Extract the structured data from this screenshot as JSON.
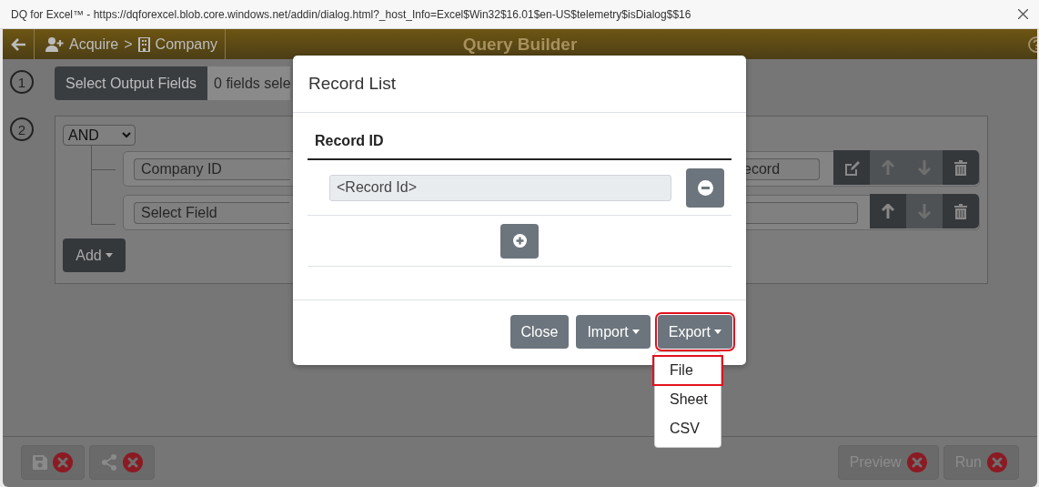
{
  "window": {
    "title": "DQ for Excel™ - https://dqforexcel.blob.core.windows.net/addin/dialog.html?_host_Info=Excel$Win32$16.01$en-US$telemetry$isDialog$$16"
  },
  "header": {
    "breadcrumb": [
      {
        "label": "Acquire",
        "kind": "user"
      },
      {
        "label": "Company",
        "kind": "building"
      }
    ],
    "separator": ">",
    "title": "Query Builder"
  },
  "output_fields": {
    "step": "1",
    "button": "Select Output Fields",
    "summary": "0 fields sele"
  },
  "query": {
    "step": "2",
    "operator": "AND",
    "rules": [
      {
        "field": "Company ID",
        "value": "ecord",
        "buttons": [
          {
            "kind": "edit",
            "disabled": false
          },
          {
            "kind": "up",
            "disabled": true
          },
          {
            "kind": "down",
            "disabled": true
          },
          {
            "kind": "delete",
            "disabled": false
          }
        ]
      },
      {
        "field": "Select Field",
        "buttons": [
          {
            "kind": "up",
            "disabled": false
          },
          {
            "kind": "down",
            "disabled": true
          },
          {
            "kind": "delete",
            "disabled": false
          }
        ]
      }
    ],
    "add_button": "Add"
  },
  "footer": {
    "left": [
      {
        "kind": "save"
      },
      {
        "kind": "share"
      }
    ],
    "right": [
      {
        "label": "Preview"
      },
      {
        "label": "Run"
      }
    ]
  },
  "dialog": {
    "title": "Record List",
    "column": "Record ID",
    "records": [
      {
        "value": "<Record Id>"
      }
    ],
    "buttons": [
      {
        "label": "Close",
        "dropdown": false,
        "highlighted": false
      },
      {
        "label": "Import",
        "dropdown": true,
        "highlighted": false
      },
      {
        "label": "Export",
        "dropdown": true,
        "highlighted": true
      }
    ],
    "menu": [
      {
        "label": "File",
        "highlighted": true
      },
      {
        "label": "Sheet",
        "highlighted": false
      },
      {
        "label": "CSV",
        "highlighted": false
      }
    ]
  }
}
